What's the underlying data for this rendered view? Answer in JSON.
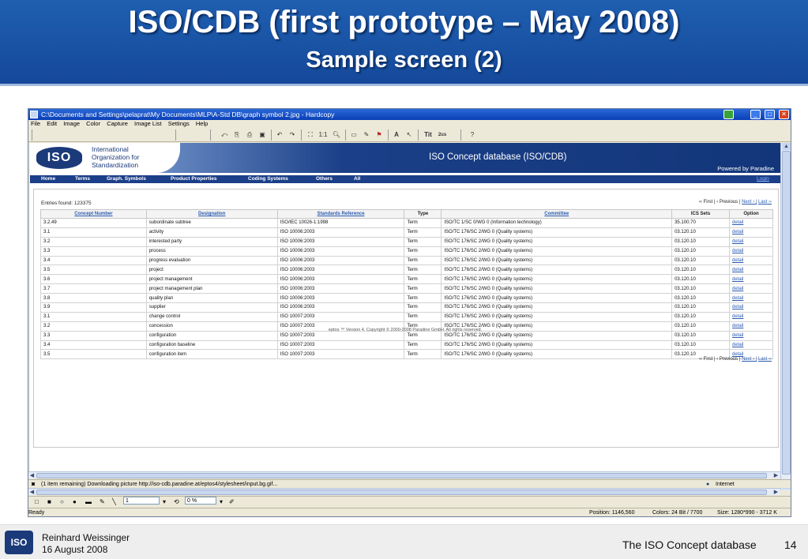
{
  "slide": {
    "title": "ISO/CDB (first prototype – May 2008)",
    "subtitle": "Sample screen (2)",
    "footer": {
      "author": "Reinhard Weissinger",
      "date": "16 August 2008",
      "title": "The ISO Concept database",
      "page": "14",
      "logo": "ISO"
    }
  },
  "window": {
    "title": "C:\\Documents and Settings\\pelaprat\\My Documents\\MLP\\A-Std DB\\graph symbol 2.jpg - Hardcopy",
    "controls": {
      "minimize": "_",
      "maximize": "□",
      "close": "✕"
    },
    "menu": [
      "File",
      "Edit",
      "Image",
      "Color",
      "Capture",
      "Image List",
      "Settings",
      "Help"
    ],
    "toolbar": {
      "zoom": "1:1",
      "text_tool": "Tit",
      "text_size": "2us",
      "text": "A"
    }
  },
  "site": {
    "logo": "ISO",
    "org_name": [
      "International",
      "Organization for",
      "Standardization"
    ],
    "title": "ISO Concept database (ISO/CDB)",
    "powered": "Powered by Paradine",
    "nav": [
      "Home",
      "Terms",
      "Graph. Symbols",
      "Product Properties",
      "Coding Systems",
      "Others",
      "All"
    ],
    "login": "Login",
    "entries": "Entries found: 123375",
    "pager": {
      "first": "‹‹ First |",
      "previous": "‹ Previous |",
      "next": "Next › |",
      "last": "Last ››"
    },
    "footer": "eptos ™ Version 4. Copyright © 2000-2008 Paradine GmbH. All rights reserved."
  },
  "table": {
    "headers": [
      "Concept Number",
      "Designation",
      "Standards Reference",
      "Type",
      "Committee",
      "ICS Sets",
      "Option"
    ],
    "rows": [
      [
        "3.2.49",
        "subordinate subtree",
        "ISO/IEC 10026-1:1998",
        "Term",
        "ISO/TC 1/SC 0/WG 0 (Information technology)",
        "35.100.70",
        "detail"
      ],
      [
        "3.1",
        "activity",
        "ISO 10006:2003",
        "Term",
        "ISO/TC 176/SC 2/WG 0 (Quality systems)",
        "03.120.10",
        "detail"
      ],
      [
        "3.2",
        "interested party",
        "ISO 10006:2003",
        "Term",
        "ISO/TC 176/SC 2/WG 0 (Quality systems)",
        "03.120.10",
        "detail"
      ],
      [
        "3.3",
        "process",
        "ISO 10006:2003",
        "Term",
        "ISO/TC 176/SC 2/WG 0 (Quality systems)",
        "03.120.10",
        "detail"
      ],
      [
        "3.4",
        "progress evaluation",
        "ISO 10006:2003",
        "Term",
        "ISO/TC 176/SC 2/WG 0 (Quality systems)",
        "03.120.10",
        "detail"
      ],
      [
        "3.5",
        "project",
        "ISO 10006:2003",
        "Term",
        "ISO/TC 176/SC 2/WG 0 (Quality systems)",
        "03.120.10",
        "detail"
      ],
      [
        "3.6",
        "project management",
        "ISO 10006:2003",
        "Term",
        "ISO/TC 176/SC 2/WG 0 (Quality systems)",
        "03.120.10",
        "detail"
      ],
      [
        "3.7",
        "project management plan",
        "ISO 10006:2003",
        "Term",
        "ISO/TC 176/SC 2/WG 0 (Quality systems)",
        "03.120.10",
        "detail"
      ],
      [
        "3.8",
        "quality plan",
        "ISO 10006:2003",
        "Term",
        "ISO/TC 176/SC 2/WG 0 (Quality systems)",
        "03.120.10",
        "detail"
      ],
      [
        "3.9",
        "supplier",
        "ISO 10006:2003",
        "Term",
        "ISO/TC 176/SC 2/WG 0 (Quality systems)",
        "03.120.10",
        "detail"
      ],
      [
        "3.1",
        "change control",
        "ISO 10007:2003",
        "Term",
        "ISO/TC 176/SC 2/WG 0 (Quality systems)",
        "03.120.10",
        "detail"
      ],
      [
        "3.2",
        "concession",
        "ISO 10007:2003",
        "Term",
        "ISO/TC 176/SC 2/WG 0 (Quality systems)",
        "03.120.10",
        "detail"
      ],
      [
        "3.3",
        "configuration",
        "ISO 10007:2003",
        "Term",
        "ISO/TC 176/SC 2/WG 0 (Quality systems)",
        "03.120.10",
        "detail"
      ],
      [
        "3.4",
        "configuration baseline",
        "ISO 10007:2003",
        "Term",
        "ISO/TC 176/SC 2/WG 0 (Quality systems)",
        "03.120.10",
        "detail"
      ],
      [
        "3.5",
        "configuration item",
        "ISO 10007:2003",
        "Term",
        "ISO/TC 176/SC 2/WG 0 (Quality systems)",
        "03.120.10",
        "detail"
      ]
    ]
  },
  "browser": {
    "status": "(1 item remaining) Downloading picture http://iso-cdb.paradine.at/eptos4/stylesheet/input.bg.gif...",
    "zone": "Internet"
  },
  "drawbar": {
    "line_width": "1",
    "opacity": "0 %"
  },
  "statusbar": {
    "ready": "Ready",
    "position": "Position: 1146,560",
    "colors": "Colors: 24 Bit / 7700",
    "size": "Size: 1280*990  -  3712 K"
  }
}
